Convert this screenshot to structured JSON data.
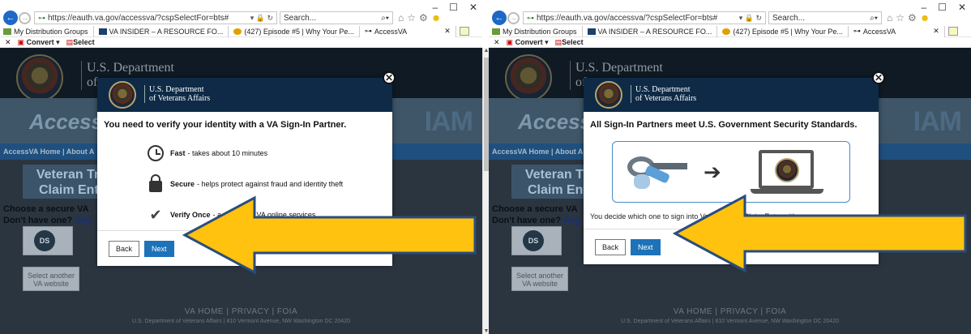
{
  "browser": {
    "url": "https://eauth.va.gov/accessva/?cspSelectFor=bts#",
    "search_placeholder": "Search...",
    "favorites": [
      {
        "label": "My Distribution Groups"
      },
      {
        "label": "VA INSIDER – A RESOURCE FO..."
      },
      {
        "label": "(427) Episode #5 | Why Your Pe..."
      }
    ],
    "active_tab": "AccessVA",
    "toolbar": {
      "convert": "Convert",
      "select": "Select"
    }
  },
  "page": {
    "dept_line1": "U.S. Department",
    "dept_line2_left": "of",
    "dept_line2_right": "of",
    "accessva_logo_left": "AccessVA",
    "accessva_logo_right": "AccessV",
    "iam_logo": "IAM",
    "nav_left": "AccessVA Home | About A",
    "nav_right": "AccessVA Home | About A",
    "service_title_left": "Veteran Tra\nClaim Entr",
    "service_title_right": "Veteran Tra\nClaim Entr",
    "choose_line1": "Choose a secure VA",
    "choose_line2": "Don't have one? ",
    "choose_reg_left": "Reg",
    "choose_reg_right": "Reg",
    "ds_label": "DS",
    "select_another": "Select another\nVA website",
    "footer_links": "VA HOME   |   PRIVACY   |   FOIA",
    "footer_address": "U.S. Department of Veterans Affairs | 810 Vermont Avenue, NW Washington DC 20420"
  },
  "modal_left": {
    "dept_line1": "U.S. Department",
    "dept_line2": "of Veterans Affairs",
    "title": "You need to verify your identity with a VA Sign-In Partner.",
    "features": [
      {
        "icon": "clock-icon",
        "bold": "Fast",
        "text": "- takes about 10 minutes"
      },
      {
        "icon": "lock-icon",
        "bold": "Secure",
        "text": "- helps protect against fraud and identity theft"
      },
      {
        "icon": "check-icon",
        "bold": "Verify Once",
        "text": "- a   ss many VA online services"
      }
    ],
    "back_label": "Back",
    "next_label": "Next",
    "close_glyph": "✕"
  },
  "modal_right": {
    "dept_line1": "U.S. Department",
    "dept_line2": "of Veterans Affairs",
    "title": "All Sign-In Partners meet U.S. Government Security Standards.",
    "decide_text": "You decide which one to sign into Veteran Tr     Claim Entry with.",
    "back_label": "Back",
    "next_label": "Next",
    "close_glyph": "✕"
  },
  "colors": {
    "va_navy": "#0e2a47",
    "next_blue": "#1d72b8",
    "arrow_yellow": "#ffc20e",
    "arrow_outline": "#2b4c7e"
  }
}
